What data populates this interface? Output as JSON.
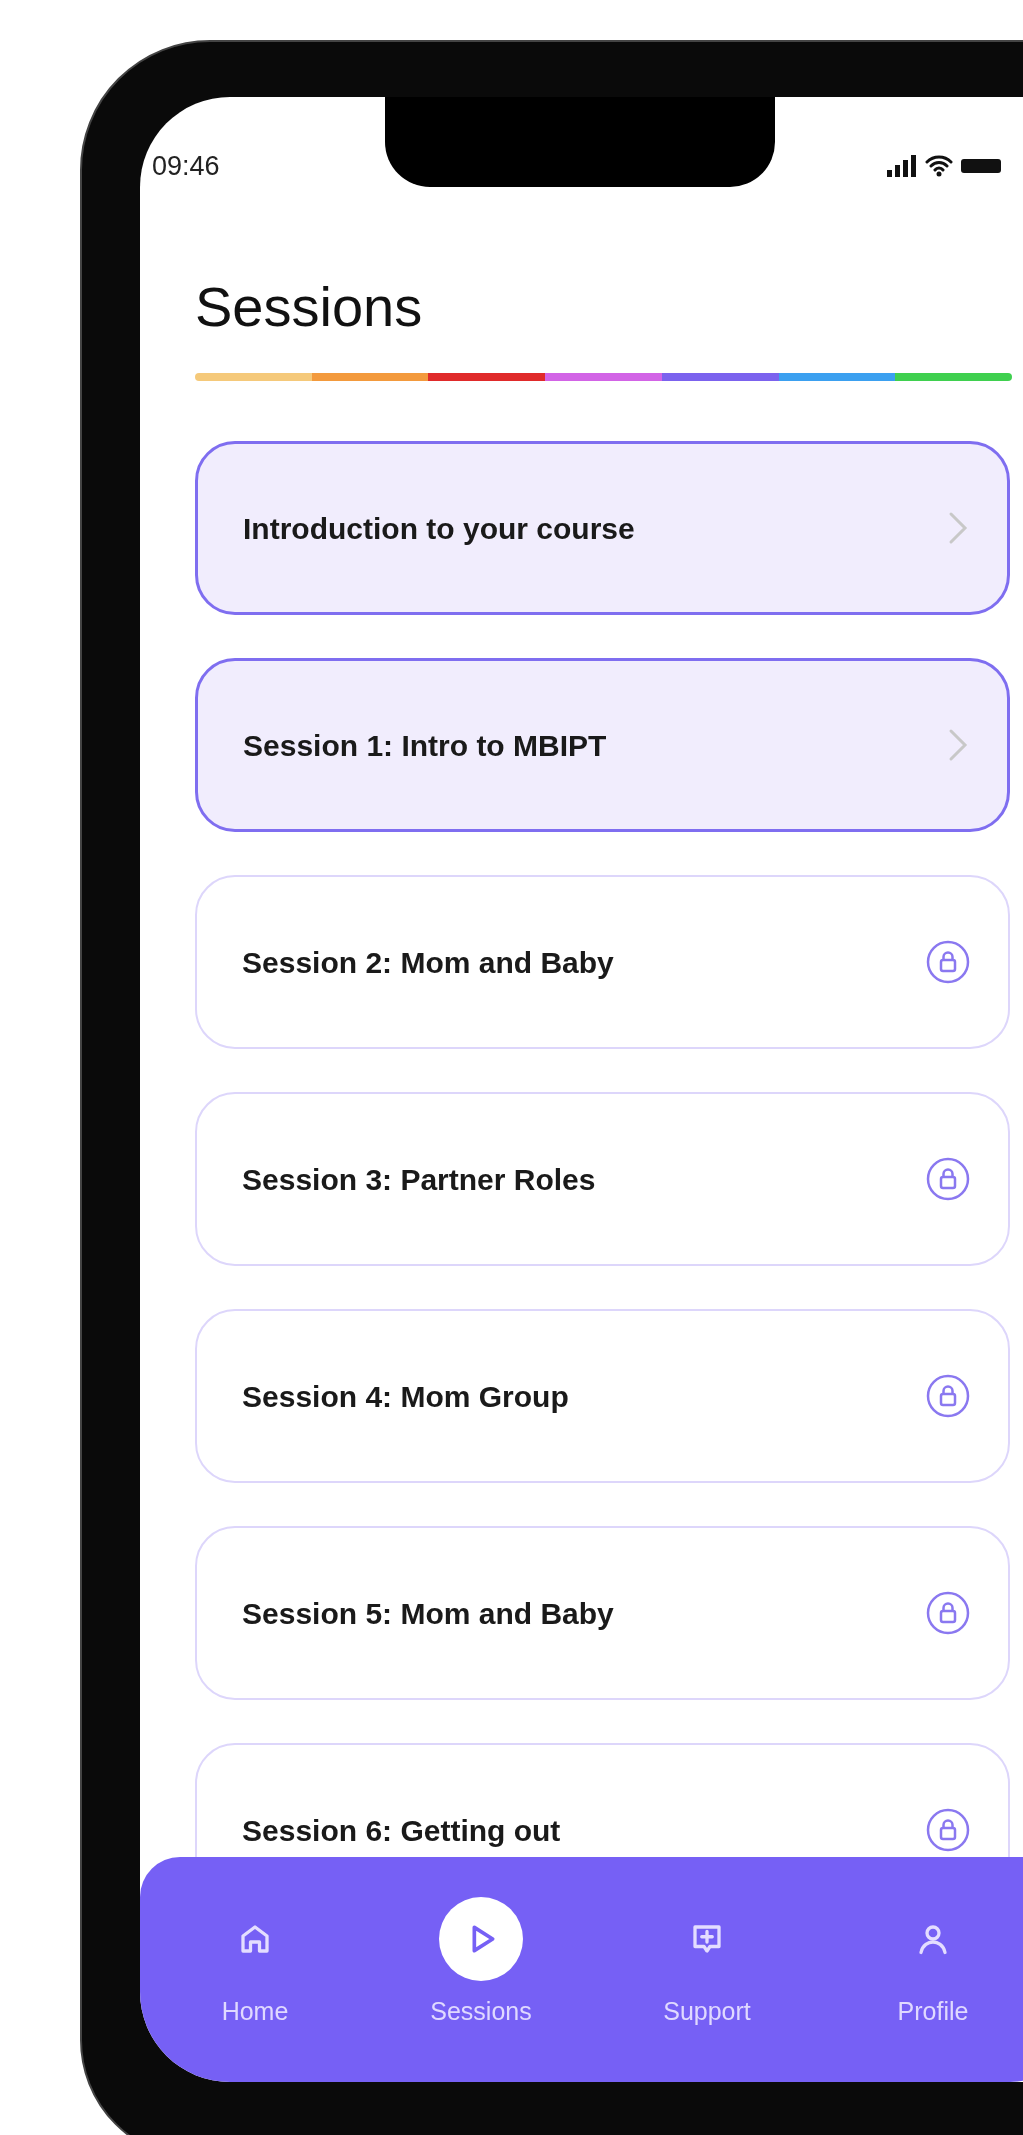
{
  "status_bar": {
    "time": "09:46"
  },
  "title": "Sessions",
  "color_bar": [
    {
      "color": "#f5c97a"
    },
    {
      "color": "#f39a3d"
    },
    {
      "color": "#e02a2a"
    },
    {
      "color": "#d264e6"
    },
    {
      "color": "#7b62ee"
    },
    {
      "color": "#3ba0f0"
    },
    {
      "color": "#3fd04f"
    }
  ],
  "sessions": [
    {
      "label": "Introduction to your course",
      "locked": false
    },
    {
      "label": "Session 1: Intro to MBIPT",
      "locked": false
    },
    {
      "label": "Session 2: Mom and Baby",
      "locked": true
    },
    {
      "label": "Session 3: Partner Roles",
      "locked": true
    },
    {
      "label": "Session 4: Mom Group",
      "locked": true
    },
    {
      "label": "Session 5: Mom and Baby",
      "locked": true
    },
    {
      "label": "Session 6: Getting out",
      "locked": true
    }
  ],
  "nav": [
    {
      "label": "Home",
      "kind": "home",
      "selected": false
    },
    {
      "label": "Sessions",
      "kind": "play",
      "selected": true
    },
    {
      "label": "Support",
      "kind": "support",
      "selected": false
    },
    {
      "label": "Profile",
      "kind": "profile",
      "selected": false
    }
  ]
}
